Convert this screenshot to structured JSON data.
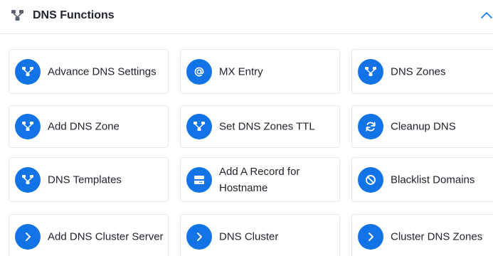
{
  "header": {
    "title": "DNS Functions",
    "icon": "sitemap-icon",
    "collapse_icon": "chevron-up-icon"
  },
  "accent_color": "#1273e6",
  "tiles": [
    {
      "label": "Advance DNS Settings",
      "icon": "sitemap-icon"
    },
    {
      "label": "MX Entry",
      "icon": "at-icon"
    },
    {
      "label": "DNS Zones",
      "icon": "sitemap-icon"
    },
    {
      "label": "Add DNS Zone",
      "icon": "sitemap-icon"
    },
    {
      "label": "Set DNS Zones TTL",
      "icon": "sitemap-icon"
    },
    {
      "label": "Cleanup DNS",
      "icon": "refresh-icon"
    },
    {
      "label": "DNS Templates",
      "icon": "sitemap-icon"
    },
    {
      "label": "Add A Record for Hostname",
      "icon": "server-icon"
    },
    {
      "label": "Blacklist Domains",
      "icon": "ban-icon"
    },
    {
      "label": "Add DNS Cluster Server",
      "icon": "chevron-right-icon"
    },
    {
      "label": "DNS Cluster",
      "icon": "chevron-right-icon"
    },
    {
      "label": "Cluster DNS Zones",
      "icon": "chevron-right-icon"
    }
  ]
}
